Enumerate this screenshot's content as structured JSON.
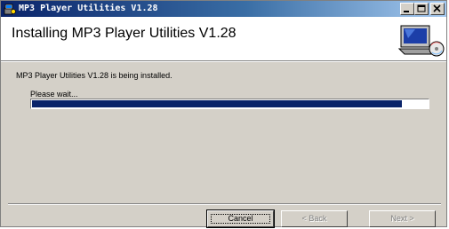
{
  "window": {
    "title": "MP3 Player Utilities V1.28",
    "icon": "installer-icon",
    "controls": [
      "minimize-icon",
      "maximize-icon",
      "close-icon"
    ]
  },
  "header": {
    "title": "Installing MP3 Player Utilities V1.28",
    "art": "computer-disc-icon"
  },
  "main": {
    "status": "MP3 Player Utilities V1.28 is being installed.",
    "progress_label": "Please wait...",
    "progress_value": 0.935
  },
  "footer": {
    "cancel_label": "Cancel",
    "back_label": "< Back",
    "next_label": "Next >"
  },
  "colors": {
    "progress_fill": "#0a246a",
    "face": "#d4d0c8"
  }
}
